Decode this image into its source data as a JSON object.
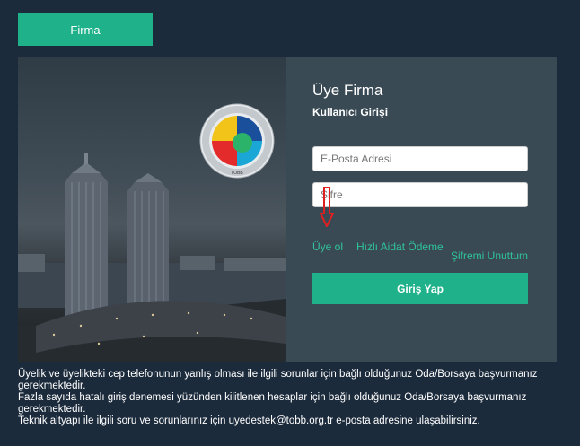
{
  "tab": {
    "label": "Firma"
  },
  "logo": {
    "ring_text": "TÜRKİYE ODALAR VE BORSALAR BİRLİĞİ",
    "abbr": "TOBB"
  },
  "login": {
    "title": "Üye Firma",
    "subtitle": "Kullanıcı Girişi",
    "email_placeholder": "E-Posta Adresi",
    "password_placeholder": "Şifre",
    "link_register": "Üye ol",
    "link_fast_pay": "Hızlı Aidat Ödeme",
    "link_forgot": "Şifremi Unuttum",
    "submit": "Giriş Yap"
  },
  "notes": [
    "Üyelik ve üyelikteki cep telefonunun yanlış olması ile ilgili sorunlar için bağlı olduğunuz Oda/Borsaya başvurmanız gerekmektedir.",
    "Fazla sayıda hatalı giriş denemesi yüzünden kilitlenen hesaplar için bağlı olduğunuz Oda/Borsaya başvurmanız gerekmektedir.",
    "Teknik altyapı ile ilgili soru ve sorunlarınız için uyedestek@tobb.org.tr e-posta adresine ulaşabilirsiniz."
  ],
  "colors": {
    "accent": "#1eb18a",
    "link": "#2fc39a",
    "background": "#1c2b3c",
    "panel": "#3a4a55",
    "arrow": "#e02020"
  }
}
